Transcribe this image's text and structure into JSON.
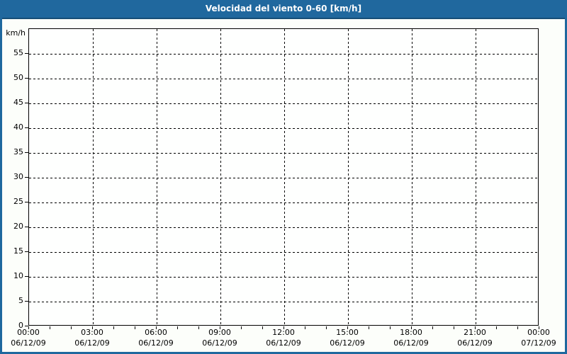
{
  "header": {
    "title": "Velocidad del viento 0-60 [km/h]"
  },
  "colors": {
    "titlebar_background": "#20689E",
    "titlebar_border_bottom": "#174E77",
    "titlebar_text": "#FFFFFF",
    "panel_border": "#1F689E",
    "panel_background": "#FCFEFA",
    "plot_background": "#FEFFFE",
    "axis_and_grid": "#000000",
    "label_text": "#000000"
  },
  "chart_data": {
    "type": "line",
    "title": "Velocidad del viento 0-60 [km/h]",
    "xlabel": "",
    "ylabel": "km/h",
    "ylim": [
      0,
      60
    ],
    "y_ticks": [
      0,
      5,
      10,
      15,
      20,
      25,
      30,
      35,
      40,
      45,
      50,
      55
    ],
    "x_range_hours": 24,
    "x_minor_tick_hours": 1,
    "x_major_tick_hours": 3,
    "x_major_ticks": [
      {
        "hour": 0,
        "time": "00:00",
        "date": "06/12/09"
      },
      {
        "hour": 3,
        "time": "03:00",
        "date": "06/12/09"
      },
      {
        "hour": 6,
        "time": "06:00",
        "date": "06/12/09"
      },
      {
        "hour": 9,
        "time": "09:00",
        "date": "06/12/09"
      },
      {
        "hour": 12,
        "time": "12:00",
        "date": "06/12/09"
      },
      {
        "hour": 15,
        "time": "15:00",
        "date": "06/12/09"
      },
      {
        "hour": 18,
        "time": "18:00",
        "date": "06/12/09"
      },
      {
        "hour": 21,
        "time": "21:00",
        "date": "06/12/09"
      },
      {
        "hour": 24,
        "time": "00:00",
        "date": "07/12/09"
      }
    ],
    "grid": {
      "style": "dashed",
      "color": "#000000"
    },
    "legend": {
      "visible": false
    },
    "series": []
  }
}
